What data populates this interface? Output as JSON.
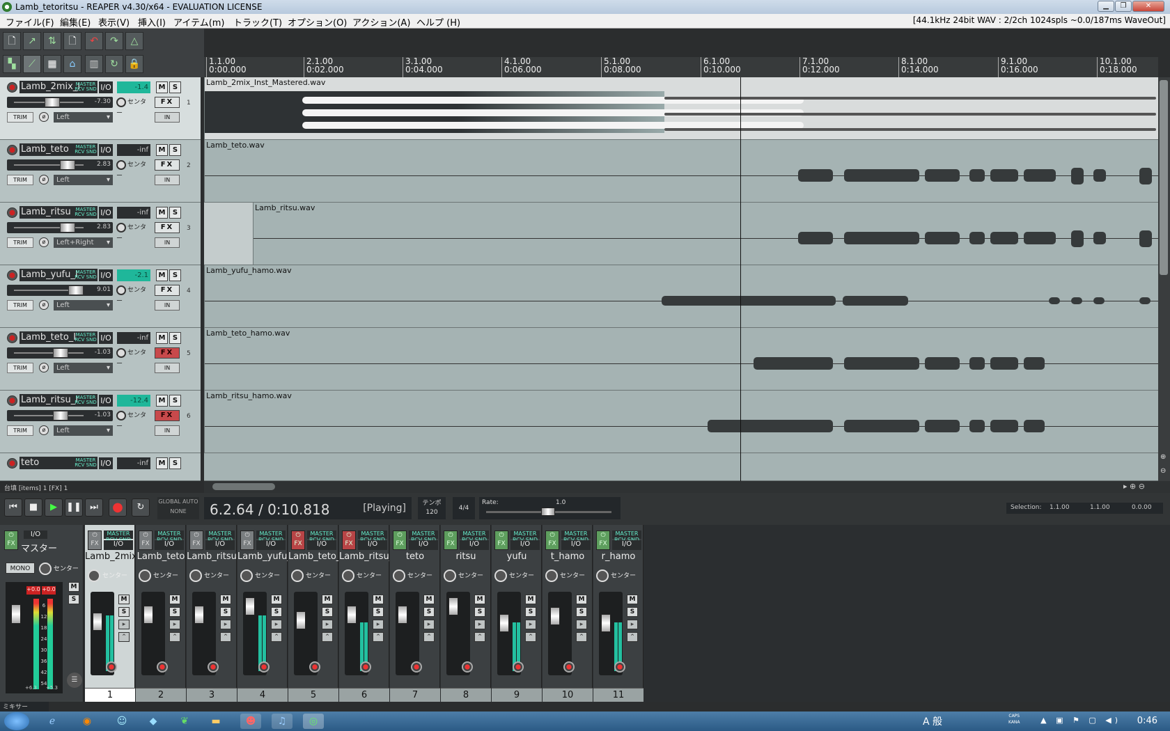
{
  "window": {
    "title": "Lamb_tetoritsu - REAPER v4.30/x64 - EVALUATION LICENSE"
  },
  "menu": {
    "items": [
      "ファイル(F)",
      "編集(E)",
      "表示(V)",
      "挿入(I)",
      "アイテム(m)",
      "トラック(T)",
      "オプション(O)",
      "アクション(A)",
      "ヘルプ (H)"
    ],
    "audio_info": "[44.1kHz 24bit WAV : 2/2ch 1024spls ~0.0/187ms WaveOut]"
  },
  "ruler": {
    "marks": [
      {
        "bar": "1.1.00",
        "time": "0:00.000"
      },
      {
        "bar": "2.1.00",
        "time": "0:02.000"
      },
      {
        "bar": "3.1.00",
        "time": "0:04.000"
      },
      {
        "bar": "4.1.00",
        "time": "0:06.000"
      },
      {
        "bar": "5.1.00",
        "time": "0:08.000"
      },
      {
        "bar": "6.1.00",
        "time": "0:10.000"
      },
      {
        "bar": "7.1.00",
        "time": "0:12.000"
      },
      {
        "bar": "8.1.00",
        "time": "0:14.000"
      },
      {
        "bar": "9.1.00",
        "time": "0:16.000"
      },
      {
        "bar": "10.1.00",
        "time": "0:18.000"
      }
    ]
  },
  "common": {
    "io": "I/O",
    "mute": "M",
    "solo": "S",
    "fx": "FX",
    "trim": "TRIM",
    "in": "IN",
    "pan_center": "センター",
    "route": "MASTER RCV SND"
  },
  "tracks": [
    {
      "name": "Lamb_2mix_I",
      "meter": "-1.4",
      "meter_active": true,
      "volume": "-7.30",
      "channel": "Left",
      "number": "1",
      "item": "Lamb_2mix_Inst_Mastered.wav",
      "fx_red": false
    },
    {
      "name": "Lamb_teto",
      "meter": "-inf",
      "meter_active": false,
      "volume": "2.83",
      "channel": "Left",
      "number": "2",
      "item": "Lamb_teto.wav",
      "fx_red": false
    },
    {
      "name": "Lamb_ritsu",
      "meter": "-inf",
      "meter_active": false,
      "volume": "2.83",
      "channel": "Left+Right",
      "number": "3",
      "item": "Lamb_ritsu.wav",
      "fx_red": false
    },
    {
      "name": "Lamb_yufu_I",
      "meter": "-2.1",
      "meter_active": true,
      "volume": "9.01",
      "channel": "Left",
      "number": "4",
      "item": "Lamb_yufu_hamo.wav",
      "fx_red": false
    },
    {
      "name": "Lamb_teto_I",
      "meter": "-inf",
      "meter_active": false,
      "volume": "-1.03",
      "channel": "Left",
      "number": "5",
      "item": "Lamb_teto_hamo.wav",
      "fx_red": true
    },
    {
      "name": "Lamb_ritsu_I",
      "meter": "-12.4",
      "meter_active": true,
      "volume": "-1.03",
      "channel": "Left",
      "number": "6",
      "item": "Lamb_ritsu_hamo.wav",
      "fx_red": true
    },
    {
      "name": "teto",
      "meter": "-inf",
      "meter_active": false,
      "volume": "",
      "channel": "",
      "number": "",
      "item": "",
      "fx_red": false
    }
  ],
  "status": {
    "text": "台填 [items] 1 [FX] 1"
  },
  "transport": {
    "position": "6.2.64 / 0:10.818",
    "state": "[Playing]",
    "global_auto": "GLOBAL AUTO",
    "global_auto_value": "NONE",
    "tempo_label": "テンポ",
    "tempo": "120",
    "timesig": "4/4",
    "rate_label": "Rate:",
    "rate": "1.0",
    "selection_label": "Selection:",
    "sel_start": "1.1.00",
    "sel_end": "1.1.00",
    "sel_len": "0.0.00"
  },
  "mixer": {
    "master_name": "マスター",
    "mono": "MONO",
    "master_peaks": [
      "+0.0",
      "+0.0"
    ],
    "master_scale": [
      "6",
      "12",
      "18",
      "24",
      "30",
      "36",
      "42",
      "54"
    ],
    "master_bottom": [
      "+6.3",
      "+5.3"
    ],
    "tab": "ミキサー",
    "strips": [
      {
        "name": "Lamb_2mix_",
        "num": "1",
        "fx": "byp"
      },
      {
        "name": "Lamb_teto",
        "num": "2",
        "fx": "byp"
      },
      {
        "name": "Lamb_ritsu",
        "num": "3",
        "fx": "byp"
      },
      {
        "name": "Lamb_yufu_",
        "num": "4",
        "fx": "byp"
      },
      {
        "name": "Lamb_teto_I",
        "num": "5",
        "fx": "red"
      },
      {
        "name": "Lamb_ritsu_",
        "num": "6",
        "fx": "red"
      },
      {
        "name": "teto",
        "num": "7",
        "fx": "green"
      },
      {
        "name": "ritsu",
        "num": "8",
        "fx": "green"
      },
      {
        "name": "yufu",
        "num": "9",
        "fx": "green"
      },
      {
        "name": "t_hamo",
        "num": "10",
        "fx": "green"
      },
      {
        "name": "r_hamo",
        "num": "11",
        "fx": "green"
      }
    ]
  },
  "taskbar": {
    "clock": "0:46",
    "ime": "A 般",
    "caps": "CAPS",
    "kana": "KANA"
  }
}
